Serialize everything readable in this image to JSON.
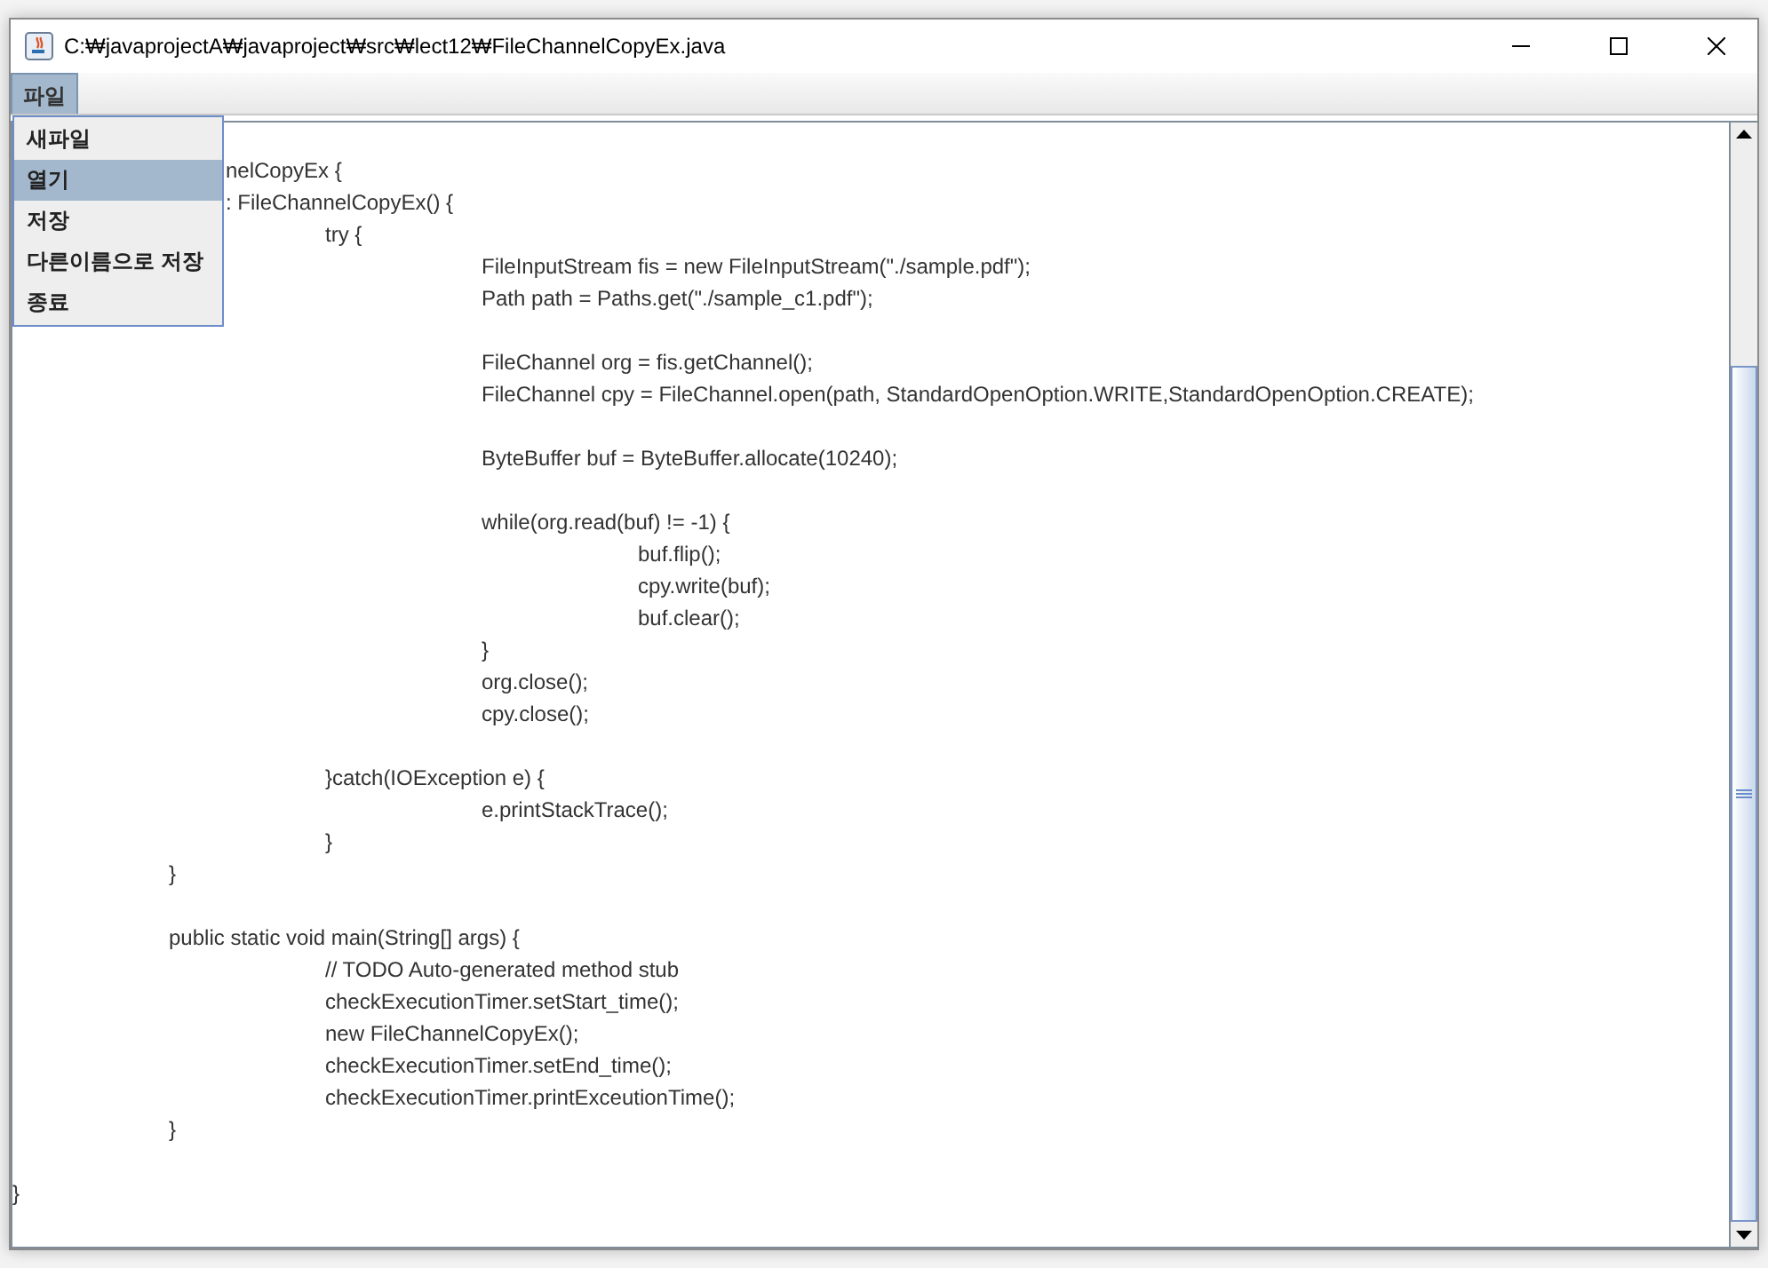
{
  "window": {
    "title": "C:₩javaprojectA₩javaproject₩src₩lect12₩FileChannelCopyEx.java"
  },
  "menu_bar": [
    {
      "label": "파일",
      "selected": true
    }
  ],
  "menu": [
    {
      "label": "새파일",
      "selected": false
    },
    {
      "label": "열기",
      "selected": true
    },
    {
      "label": "저장",
      "selected": false
    },
    {
      "label": "다른이름으로 저장",
      "selected": false
    },
    {
      "label": "종료",
      "selected": false
    }
  ],
  "editor": {
    "lines": [
      {
        "kind": "partial",
        "text": "nelCopyEx {"
      },
      {
        "kind": "partial",
        "text": ": FileChannelCopyEx() {"
      },
      {
        "kind": "code",
        "text": "\t\ttry {"
      },
      {
        "kind": "code",
        "text": "\t\t\tFileInputStream fis = new FileInputStream(\"./sample.pdf\");"
      },
      {
        "kind": "code",
        "text": "\t\t\tPath path = Paths.get(\"./sample_c1.pdf\");"
      },
      {
        "kind": "blank"
      },
      {
        "kind": "code",
        "text": "\t\t\tFileChannel org = fis.getChannel();"
      },
      {
        "kind": "code",
        "text": "\t\t\tFileChannel cpy = FileChannel.open(path, StandardOpenOption.WRITE,StandardOpenOption.CREATE);"
      },
      {
        "kind": "blank"
      },
      {
        "kind": "code",
        "text": "\t\t\tByteBuffer buf = ByteBuffer.allocate(10240);"
      },
      {
        "kind": "blank"
      },
      {
        "kind": "code",
        "text": "\t\t\twhile(org.read(buf) != -1) {"
      },
      {
        "kind": "code",
        "text": "\t\t\t\tbuf.flip();"
      },
      {
        "kind": "code",
        "text": "\t\t\t\tcpy.write(buf);"
      },
      {
        "kind": "code",
        "text": "\t\t\t\tbuf.clear();"
      },
      {
        "kind": "code",
        "text": "\t\t\t}"
      },
      {
        "kind": "code",
        "text": "\t\t\torg.close();"
      },
      {
        "kind": "code",
        "text": "\t\t\tcpy.close();"
      },
      {
        "kind": "blank"
      },
      {
        "kind": "code",
        "text": "\t\t}catch(IOException e) {"
      },
      {
        "kind": "code",
        "text": "\t\t\te.printStackTrace();"
      },
      {
        "kind": "code",
        "text": "\t\t}"
      },
      {
        "kind": "code",
        "text": "\t}"
      },
      {
        "kind": "blank"
      },
      {
        "kind": "code",
        "text": "\tpublic static void main(String[] args) {"
      },
      {
        "kind": "code",
        "text": "\t\t// TODO Auto-generated method stub"
      },
      {
        "kind": "code",
        "text": "\t\tcheckExecutionTimer.setStart_time();"
      },
      {
        "kind": "code",
        "text": "\t\tnew FileChannelCopyEx();"
      },
      {
        "kind": "code",
        "text": "\t\tcheckExecutionTimer.setEnd_time();"
      },
      {
        "kind": "code",
        "text": "\t\tcheckExecutionTimer.printExceutionTime();"
      },
      {
        "kind": "code",
        "text": "\t}"
      },
      {
        "kind": "blank"
      },
      {
        "kind": "code",
        "text": "}"
      }
    ]
  }
}
